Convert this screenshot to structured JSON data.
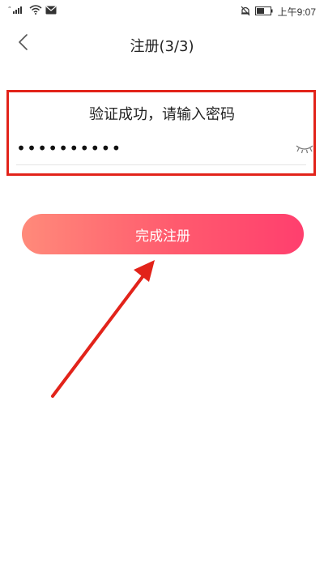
{
  "status_bar": {
    "time": "上午9:07",
    "icons": [
      "signal-icon",
      "wifi-icon",
      "mail-icon",
      "mute-icon",
      "battery-icon"
    ]
  },
  "header": {
    "title": "注册(3/3)",
    "back_icon": "chevron-left-icon"
  },
  "form": {
    "prompt": "验证成功，请输入密码",
    "password_value": "••••••••••",
    "password_toggle_icon": "eye-closed-icon",
    "highlight_color": "#e2231a"
  },
  "actions": {
    "complete_label": "完成注册"
  },
  "colors": {
    "button_gradient_start": "#ff8a7a",
    "button_gradient_end": "#ff3f6e",
    "annotation": "#e2231a"
  }
}
